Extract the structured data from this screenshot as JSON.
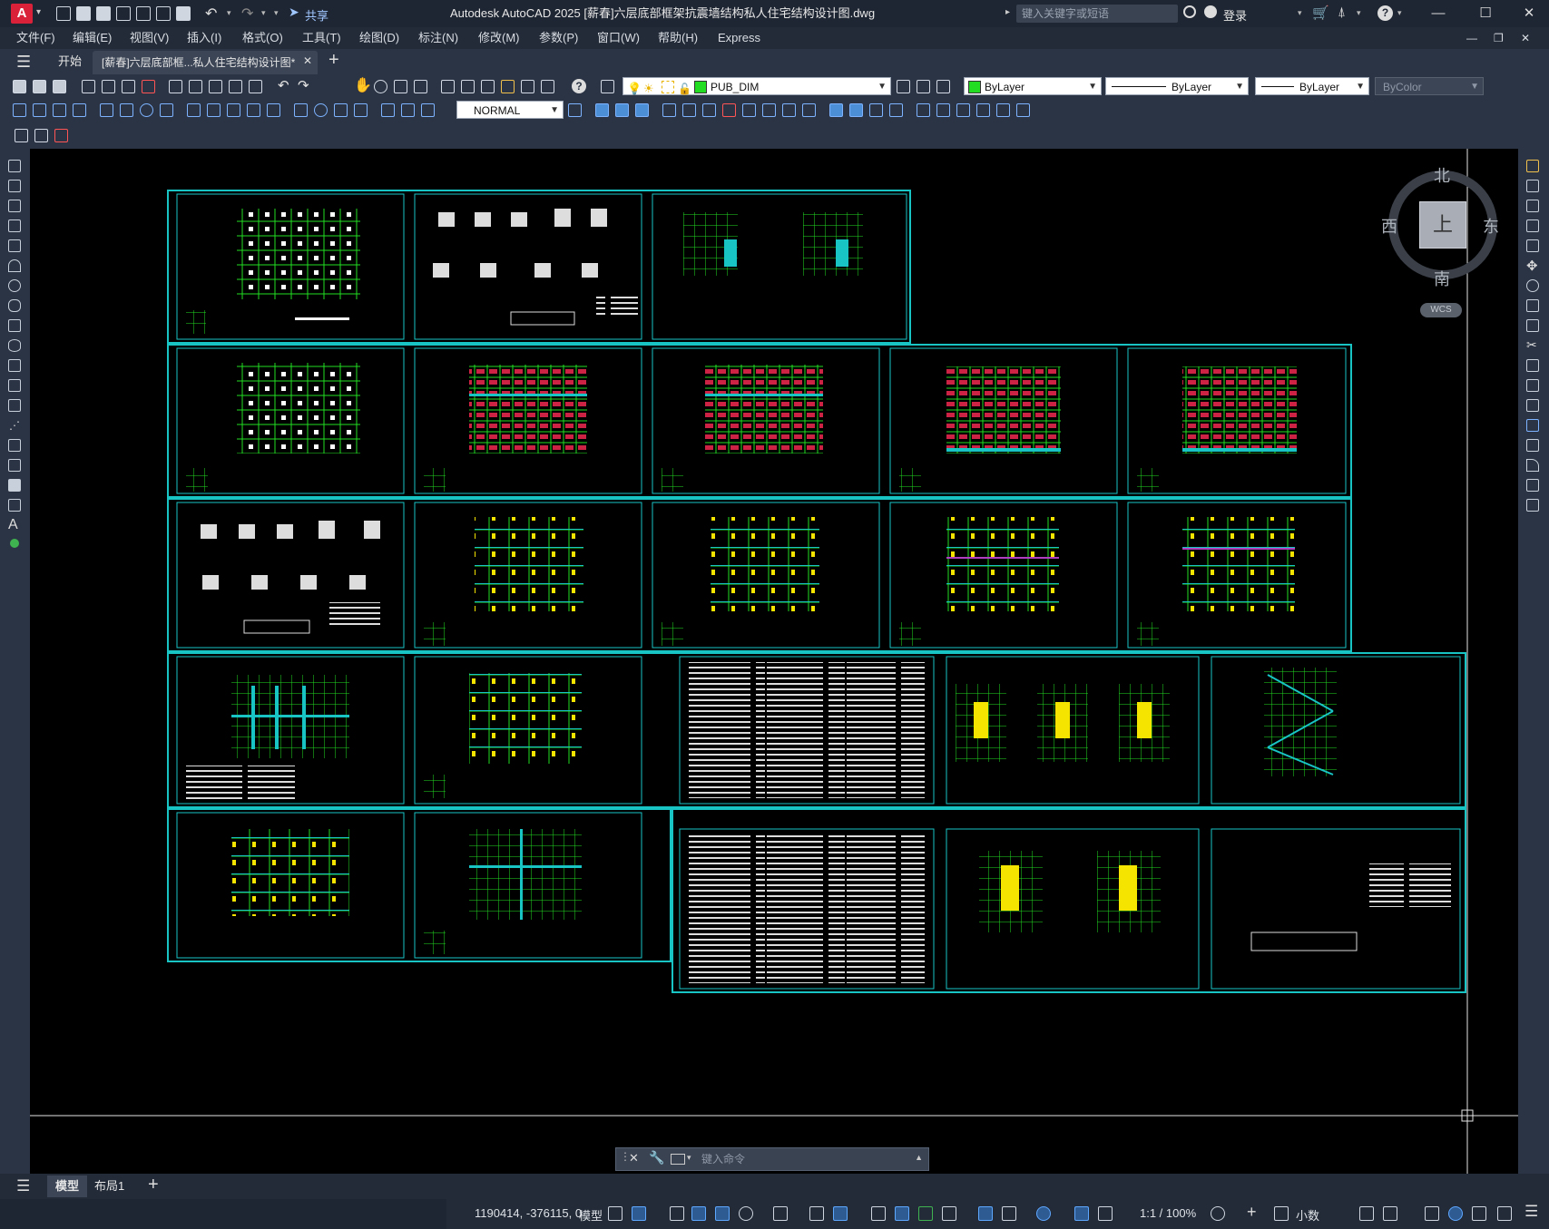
{
  "app": {
    "logo_letter": "A",
    "title": "Autodesk AutoCAD 2025    [薪春]六层底部框架抗震墙结构私人住宅结构设计图.dwg",
    "share_label": "共享",
    "search_placeholder": "键入关键字或短语",
    "login_label": "登录",
    "window_controls": [
      "minimize-icon",
      "maximize-icon",
      "close-icon"
    ]
  },
  "menu": {
    "items": [
      "文件(F)",
      "编辑(E)",
      "视图(V)",
      "插入(I)",
      "格式(O)",
      "工具(T)",
      "绘图(D)",
      "标注(N)",
      "修改(M)",
      "参数(P)",
      "窗口(W)",
      "帮助(H)",
      "Express"
    ]
  },
  "tabs": {
    "start_label": "开始",
    "document_label": "[薪春]六层底部框...私人住宅结构设计图*"
  },
  "toolbar": {
    "layer_name": "PUB_DIM",
    "color_value": "ByLayer",
    "linetype_value": "ByLayer",
    "lineweight_value": "ByLayer",
    "plotstyle_value": "ByColor",
    "dimstyle_value": "NORMAL",
    "accent_green": "#22dd22"
  },
  "viewcube": {
    "north": "北",
    "south": "南",
    "east": "东",
    "west": "西",
    "face": "上",
    "wcs_label": "WCS"
  },
  "command": {
    "placeholder": "键入命令"
  },
  "layout_tabs": {
    "model": "模型",
    "layout1": "布局1"
  },
  "status": {
    "coordinates": "1190414, -376115, 0",
    "space": "模型",
    "scale": "1:1 / 100%",
    "units": "小数"
  }
}
